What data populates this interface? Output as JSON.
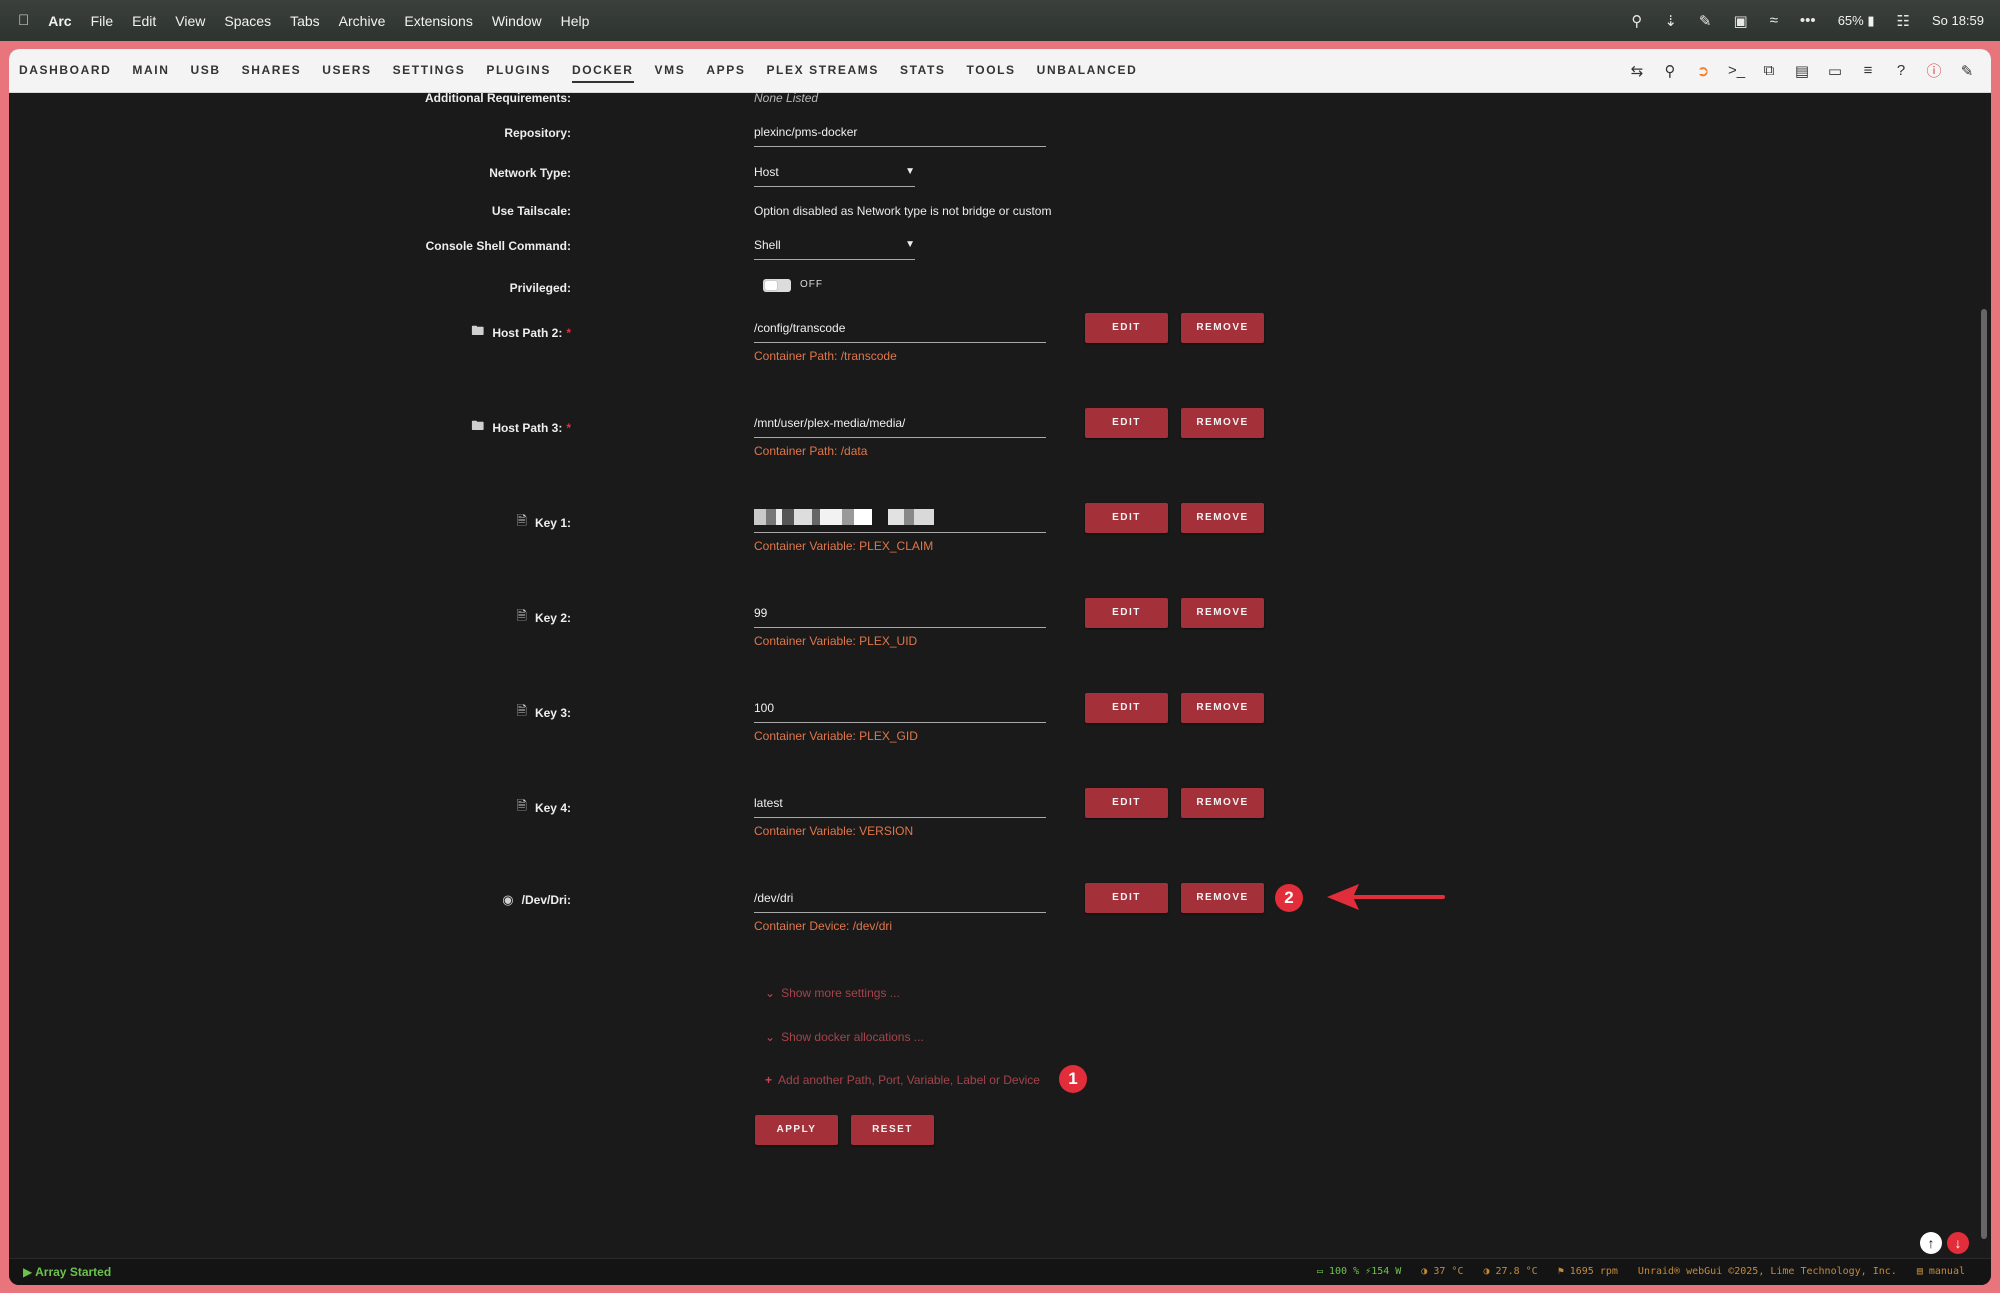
{
  "mac_menubar": {
    "apple_icon": "apple-icon",
    "app": "Arc",
    "menus": [
      "File",
      "Edit",
      "View",
      "Spaces",
      "Tabs",
      "Archive",
      "Extensions",
      "Window",
      "Help"
    ],
    "battery": "65%",
    "clock": "So 18:59"
  },
  "nav": {
    "tabs": [
      "DASHBOARD",
      "MAIN",
      "USB",
      "SHARES",
      "USERS",
      "SETTINGS",
      "PLUGINS",
      "DOCKER",
      "VMS",
      "APPS",
      "PLEX STREAMS",
      "STATS",
      "TOOLS",
      "UNBALANCED"
    ],
    "active_tab": "DOCKER"
  },
  "form": {
    "additional_requirements": {
      "label": "Additional Requirements:",
      "value": "None Listed"
    },
    "repository": {
      "label": "Repository:",
      "value": "plexinc/pms-docker"
    },
    "network_type": {
      "label": "Network Type:",
      "value": "Host"
    },
    "use_tailscale": {
      "label": "Use Tailscale:",
      "value": "Option disabled as Network type is not bridge or custom"
    },
    "console_shell": {
      "label": "Console Shell Command:",
      "value": "Shell"
    },
    "privileged": {
      "label": "Privileged:",
      "state": "OFF"
    },
    "entries": [
      {
        "label": "Host Path 2:",
        "required": true,
        "icon": "folder-icon",
        "value": "/config/transcode",
        "sub": "Container Path: /transcode"
      },
      {
        "label": "Host Path 3:",
        "required": true,
        "icon": "folder-icon",
        "value": "/mnt/user/plex-media/media/",
        "sub": "Container Path: /data"
      },
      {
        "label": "Key 1:",
        "required": false,
        "icon": "document-icon",
        "value": "",
        "sub": "Container Variable: PLEX_CLAIM"
      },
      {
        "label": "Key 2:",
        "required": false,
        "icon": "document-icon",
        "value": "99",
        "sub": "Container Variable: PLEX_UID"
      },
      {
        "label": "Key 3:",
        "required": false,
        "icon": "document-icon",
        "value": "100",
        "sub": "Container Variable: PLEX_GID"
      },
      {
        "label": "Key 4:",
        "required": false,
        "icon": "document-icon",
        "value": "latest",
        "sub": "Container Variable: VERSION"
      },
      {
        "label": "/Dev/Dri:",
        "required": false,
        "icon": "device-icon",
        "value": "/dev/dri",
        "sub": "Container Device: /dev/dri"
      }
    ],
    "edit_label": "EDIT",
    "remove_label": "REMOVE",
    "show_more": "Show more settings ...",
    "show_allocations": "Show docker allocations ...",
    "add_another": "Add another Path, Port, Variable, Label or Device",
    "apply": "APPLY",
    "reset": "RESET",
    "annotations": {
      "badge1": "1",
      "badge2": "2",
      "arrow_color": "#e22d3a"
    }
  },
  "statusbar": {
    "array": "Array Started",
    "ups": "100 %",
    "power": "154 W",
    "cpu_temp": "37 °C",
    "mb_temp": "27.8 °C",
    "fan": "1695 rpm",
    "copyright": "Unraid® webGui ©2025, Lime Technology, Inc.",
    "manual": "manual"
  }
}
